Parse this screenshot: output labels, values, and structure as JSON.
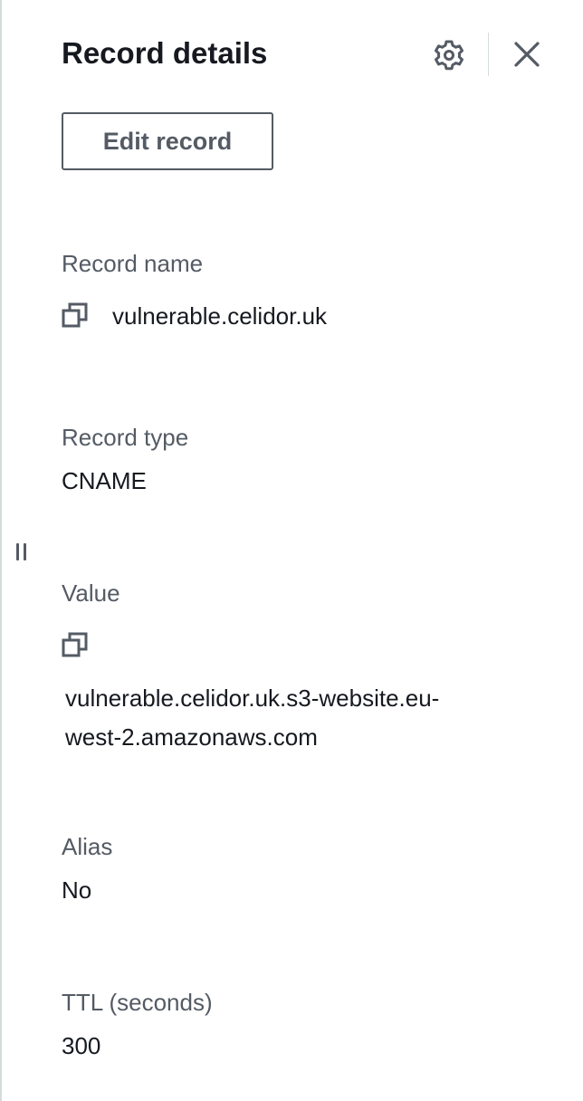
{
  "panel": {
    "title": "Record details",
    "edit_button_label": "Edit record",
    "icons": {
      "settings": "gear-icon",
      "close": "close-icon",
      "copy": "copy-icon",
      "resize": "resize-handle-icon"
    }
  },
  "fields": {
    "record_name": {
      "label": "Record name",
      "value": "vulnerable.celidor.uk"
    },
    "record_type": {
      "label": "Record type",
      "value": "CNAME"
    },
    "value": {
      "label": "Value",
      "line1": "vulnerable.celidor.uk.s3-website.eu-",
      "line2": "west-2.amazonaws.com"
    },
    "alias": {
      "label": "Alias",
      "value": "No"
    },
    "ttl": {
      "label": "TTL (seconds)",
      "value": "300"
    }
  },
  "colors": {
    "text_primary": "#16191f",
    "text_secondary": "#545b64",
    "border": "#d5dbdb"
  }
}
